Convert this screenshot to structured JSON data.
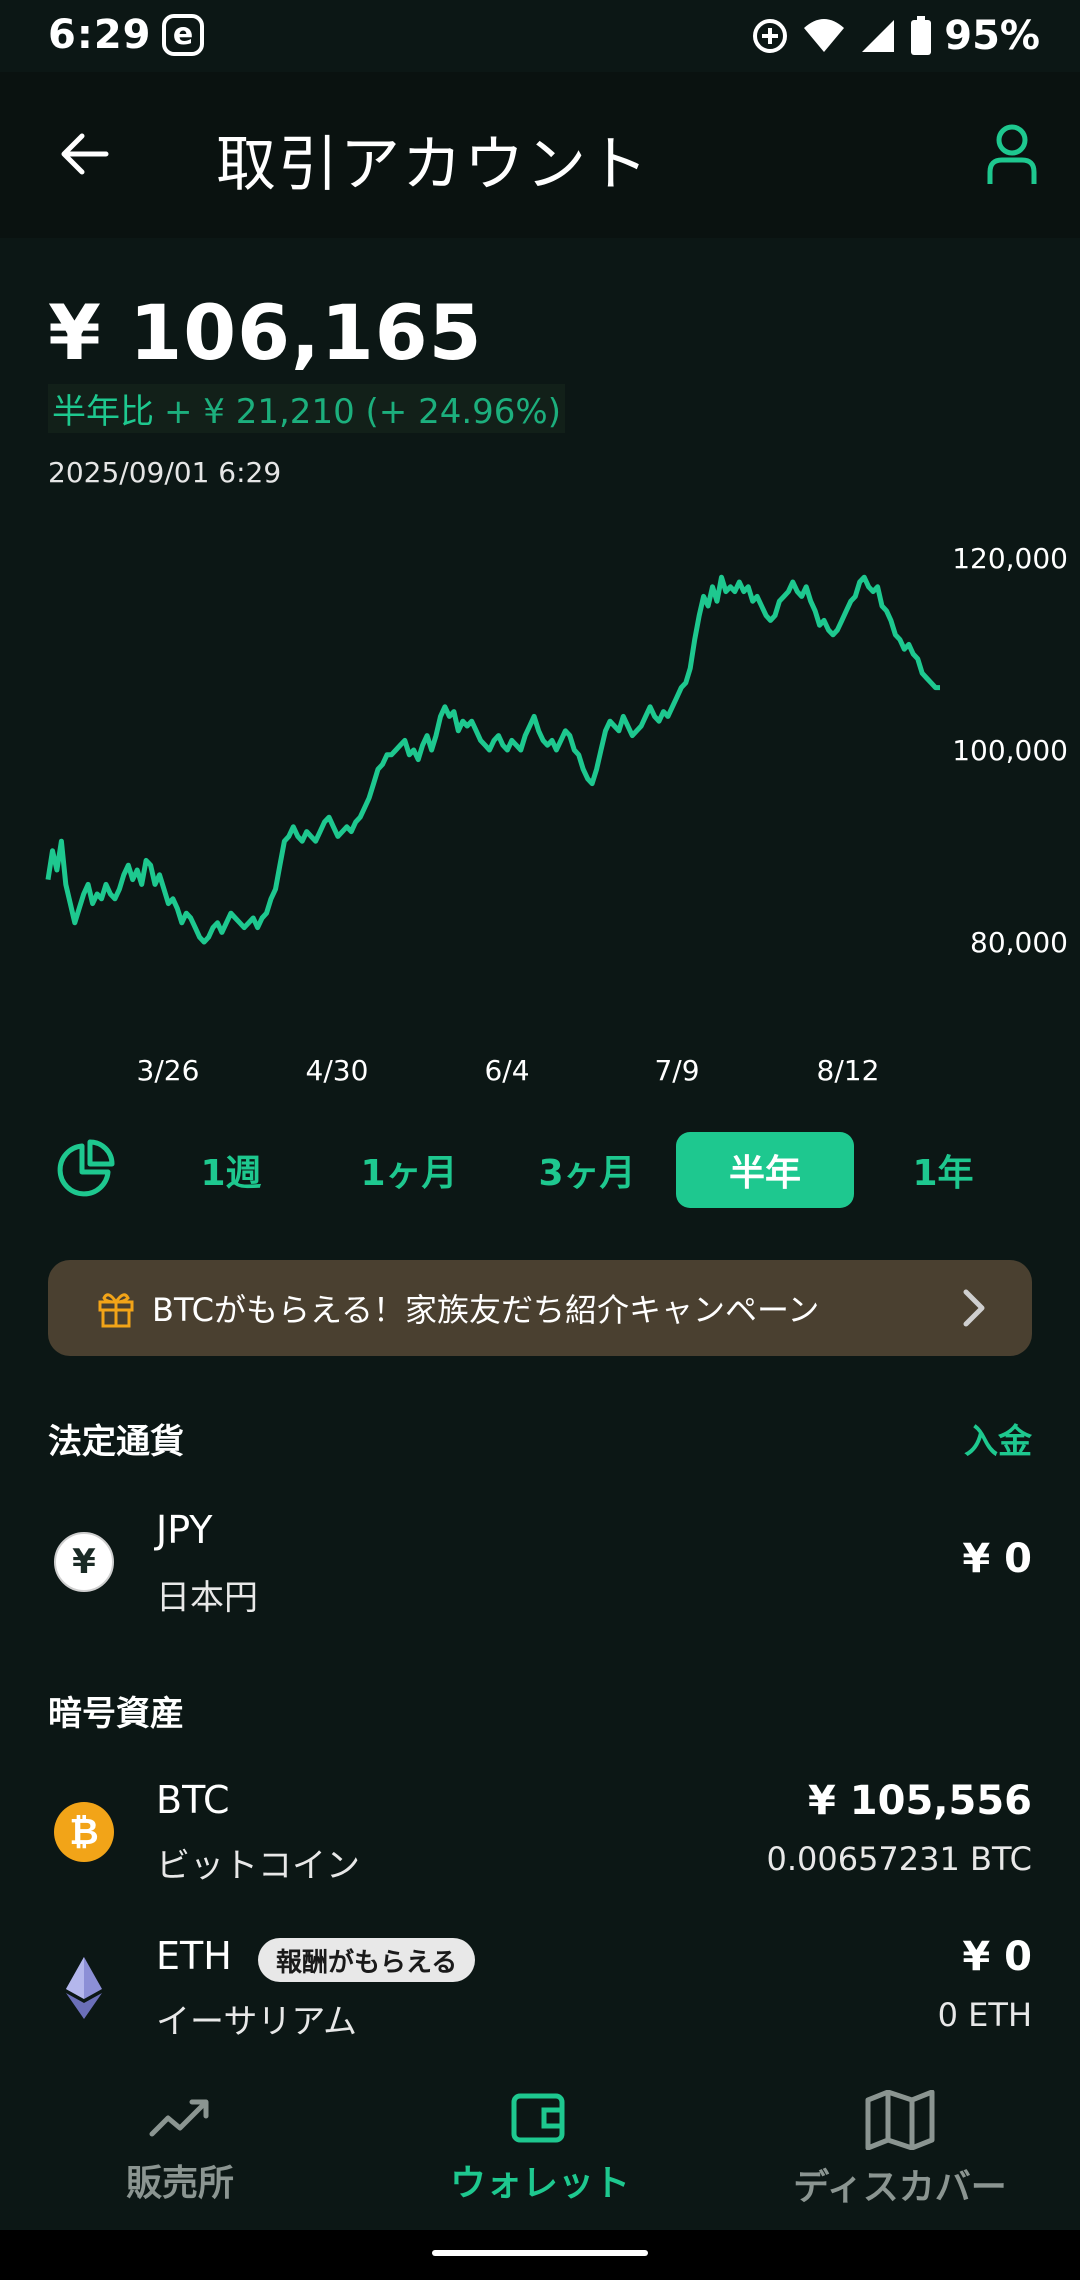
{
  "status_bar": {
    "time": "6:29",
    "app_badge": "e",
    "battery": "95%"
  },
  "header": {
    "title": "取引アカウント"
  },
  "balance": {
    "amount": "¥ 106,165",
    "change_label": "半年比",
    "change_value": "+ ¥ 21,210 (+ 24.96%)",
    "timestamp": "2025/09/01 6:29"
  },
  "chart_data": {
    "type": "line",
    "x_tick_labels": [
      "3/26",
      "4/30",
      "6/4",
      "7/9",
      "8/12"
    ],
    "y_tick_labels": [
      "120,000",
      "100,000",
      "80,000"
    ],
    "y_ticks": [
      120000,
      100000,
      80000
    ],
    "ylim": [
      72000,
      122000
    ],
    "grid": false,
    "color": "#1ec88f",
    "values": [
      86500,
      89500,
      87500,
      90500,
      86000,
      84000,
      82000,
      83500,
      85000,
      86000,
      84000,
      85000,
      84500,
      86000,
      85000,
      84500,
      85500,
      87000,
      88000,
      86500,
      87500,
      86000,
      88500,
      88000,
      86000,
      87000,
      85500,
      84000,
      84500,
      83500,
      82000,
      83000,
      82500,
      81500,
      80500,
      80000,
      80500,
      81500,
      82000,
      81000,
      82000,
      83000,
      82500,
      82000,
      81500,
      82000,
      82500,
      81500,
      82500,
      83000,
      84500,
      85500,
      88000,
      90500,
      91000,
      92000,
      91000,
      90500,
      91500,
      91000,
      90500,
      91500,
      92500,
      93000,
      92000,
      91000,
      91500,
      92000,
      91500,
      92500,
      93000,
      94000,
      95000,
      96500,
      98000,
      98500,
      99500,
      99500,
      100000,
      100500,
      101000,
      99500,
      100000,
      99000,
      100500,
      101500,
      100000,
      101500,
      103500,
      104500,
      103500,
      104000,
      102000,
      103000,
      102500,
      103000,
      102000,
      101000,
      100500,
      100000,
      101000,
      101500,
      100500,
      100000,
      101000,
      100500,
      100000,
      101500,
      102500,
      103500,
      102000,
      101000,
      100500,
      101000,
      100000,
      101000,
      102000,
      101500,
      100000,
      99500,
      98000,
      97000,
      96500,
      98000,
      100000,
      102000,
      103000,
      102500,
      102000,
      103500,
      102500,
      101500,
      102000,
      102500,
      103500,
      104500,
      103500,
      103000,
      104000,
      103500,
      104500,
      105500,
      106500,
      107000,
      108500,
      111500,
      114000,
      116000,
      115000,
      117000,
      115500,
      118000,
      116500,
      117000,
      116500,
      117500,
      116500,
      117000,
      115500,
      116000,
      115000,
      114000,
      113500,
      114000,
      115500,
      116000,
      116500,
      117500,
      116500,
      116000,
      117000,
      115500,
      114500,
      113000,
      113500,
      112500,
      112000,
      112500,
      113500,
      114500,
      115500,
      116000,
      117500,
      118000,
      117000,
      116500,
      117000,
      115000,
      114500,
      113500,
      112000,
      111500,
      110500,
      111000,
      110000,
      109500,
      108000,
      107500,
      107000,
      106500,
      106500
    ]
  },
  "range_tabs": [
    "1週",
    "1ヶ月",
    "3ヶ月",
    "半年",
    "1年"
  ],
  "active_range": "半年",
  "banner": {
    "text": "BTCがもらえる！家族友だち紹介キャンペーン"
  },
  "fiat_section": {
    "title": "法定通貨",
    "action": "入金",
    "items": [
      {
        "icon_symbol": "¥",
        "code": "JPY",
        "name": "日本円",
        "value": "¥ 0",
        "amount": ""
      }
    ]
  },
  "crypto_section": {
    "title": "暗号資産",
    "items": [
      {
        "icon_symbol": "₿",
        "code": "BTC",
        "name": "ビットコイン",
        "value": "¥ 105,556",
        "amount": "0.00657231 BTC",
        "badge": ""
      },
      {
        "icon_symbol": "",
        "code": "ETH",
        "name": "イーサリアム",
        "value": "¥ 0",
        "amount": "0 ETH",
        "badge": "報酬がもらえる"
      }
    ]
  },
  "bottom_nav": [
    {
      "label": "販売所",
      "icon": "trend-icon",
      "active": false
    },
    {
      "label": "ウォレット",
      "icon": "wallet-icon",
      "active": true
    },
    {
      "label": "ディスカバー",
      "icon": "map-icon",
      "active": false
    }
  ],
  "colors": {
    "accent": "#1ec88f",
    "background": "#0c1715",
    "banner": "#4a4030",
    "btc": "#f2a418"
  }
}
